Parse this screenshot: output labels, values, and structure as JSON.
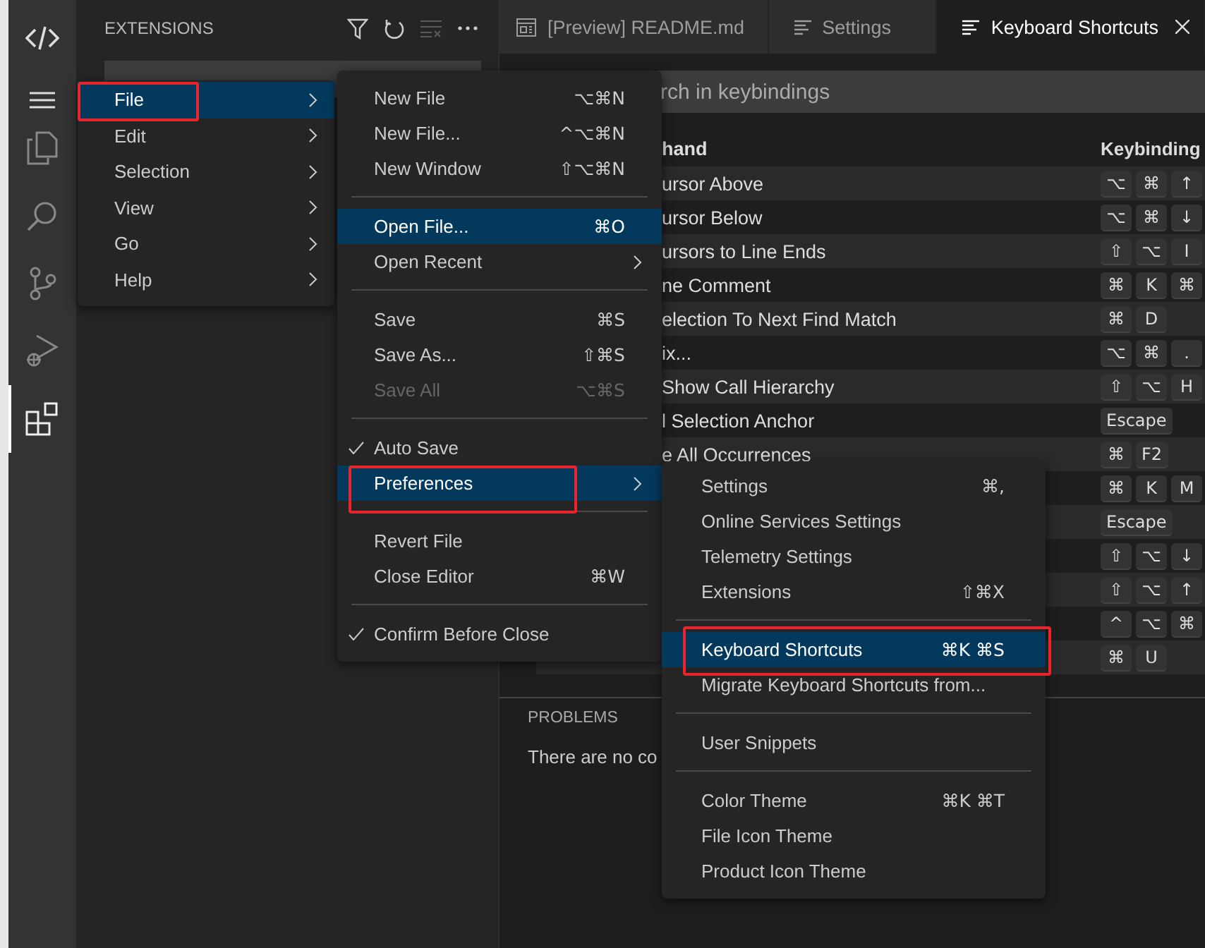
{
  "activity_bar": {
    "items": [
      {
        "kind": "logo",
        "selected": false
      },
      {
        "kind": "menu",
        "selected": false
      },
      {
        "kind": "files",
        "selected": false
      },
      {
        "kind": "search",
        "selected": false
      },
      {
        "kind": "source-control",
        "selected": false
      },
      {
        "kind": "run",
        "selected": false
      },
      {
        "kind": "extensions",
        "selected": true
      }
    ]
  },
  "sidebar": {
    "title": "EXTENSIONS",
    "actions": [
      {
        "kind": "filter",
        "disabled": false
      },
      {
        "kind": "refresh",
        "disabled": false
      },
      {
        "kind": "clear",
        "disabled": true
      },
      {
        "kind": "more",
        "disabled": false
      }
    ]
  },
  "tabs": [
    {
      "label": "[Preview] README.md",
      "kind": "preview",
      "selected": false,
      "closable": false
    },
    {
      "label": "Settings",
      "kind": "settings",
      "selected": false,
      "closable": false
    },
    {
      "label": "Keyboard Shortcuts",
      "kind": "settings",
      "selected": true,
      "closable": true
    }
  ],
  "keybindings": {
    "search": {
      "placeholder": "rch in keybindings"
    },
    "columns": [
      "hand",
      "Keybinding"
    ],
    "rows": [
      {
        "command": "ursor Above",
        "keys": [
          "⌥",
          "⌘",
          "↑"
        ]
      },
      {
        "command": "ursor Below",
        "keys": [
          "⌥",
          "⌘",
          "↓"
        ]
      },
      {
        "command": "ursors to Line Ends",
        "keys": [
          "⇧",
          "⌥",
          "I"
        ]
      },
      {
        "command": "ne Comment",
        "keys": [
          "⌘",
          "K",
          "⌘"
        ]
      },
      {
        "command": "election To Next Find Match",
        "keys": [
          "⌘",
          "D"
        ]
      },
      {
        "command": "ix...",
        "keys": [
          "⌥",
          "⌘",
          "."
        ]
      },
      {
        "command": "Show Call Hierarchy",
        "keys": [
          "⇧",
          "⌥",
          "H"
        ]
      },
      {
        "command": "l Selection Anchor",
        "keys": [
          "Escape"
        ]
      },
      {
        "command": "e All Occurrences",
        "keys": [
          "⌘",
          "F2"
        ]
      },
      {
        "keys": [
          "⌘",
          "K",
          "M"
        ]
      },
      {
        "keys": [
          "Escape"
        ]
      },
      {
        "keys": [
          "⇧",
          "⌥",
          "↓"
        ]
      },
      {
        "keys": [
          "⇧",
          "⌥",
          "↑"
        ]
      },
      {
        "keys": [
          "^",
          "⌥",
          "⌘"
        ]
      },
      {
        "keys": [
          "⌘",
          "U"
        ]
      }
    ]
  },
  "panel": {
    "tabs": [
      {
        "label": "PROBLEMS"
      }
    ],
    "message": "There are no co"
  },
  "menubar_menu": {
    "items": [
      {
        "label": "File",
        "selected": true,
        "highlighted": true
      },
      {
        "label": "Edit",
        "selected": false,
        "highlighted": false
      },
      {
        "label": "Selection",
        "selected": false,
        "highlighted": false
      },
      {
        "label": "View",
        "selected": false,
        "highlighted": false
      },
      {
        "label": "Go",
        "selected": false,
        "highlighted": false
      },
      {
        "label": "Help",
        "selected": false,
        "highlighted": false
      }
    ]
  },
  "file_menu": {
    "items": [
      {
        "kind": "item",
        "label": "New File",
        "shortcut": "⌥⌘N",
        "selected": false,
        "checked": false,
        "disabled": false,
        "submenu": false,
        "highlighted": false
      },
      {
        "kind": "item",
        "label": "New File...",
        "shortcut": "^⌥⌘N",
        "selected": false,
        "checked": false,
        "disabled": false,
        "submenu": false,
        "highlighted": false
      },
      {
        "kind": "item",
        "label": "New Window",
        "shortcut": "⇧⌥⌘N",
        "selected": false,
        "checked": false,
        "disabled": false,
        "submenu": false,
        "highlighted": false
      },
      {
        "kind": "separator"
      },
      {
        "kind": "item",
        "label": "Open File...",
        "shortcut": "⌘O",
        "selected": true,
        "checked": false,
        "disabled": false,
        "submenu": false,
        "highlighted": false
      },
      {
        "kind": "item",
        "label": "Open Recent",
        "selected": false,
        "checked": false,
        "disabled": false,
        "submenu": true,
        "highlighted": false
      },
      {
        "kind": "separator"
      },
      {
        "kind": "item",
        "label": "Save",
        "shortcut": "⌘S",
        "selected": false,
        "checked": false,
        "disabled": false,
        "submenu": false,
        "highlighted": false
      },
      {
        "kind": "item",
        "label": "Save As...",
        "shortcut": "⇧⌘S",
        "selected": false,
        "checked": false,
        "disabled": false,
        "submenu": false,
        "highlighted": false
      },
      {
        "kind": "item",
        "label": "Save All",
        "shortcut": "⌥⌘S",
        "selected": false,
        "checked": false,
        "disabled": true,
        "submenu": false,
        "highlighted": false
      },
      {
        "kind": "separator"
      },
      {
        "kind": "item",
        "label": "Auto Save",
        "selected": false,
        "checked": true,
        "disabled": false,
        "submenu": false,
        "highlighted": false
      },
      {
        "kind": "item",
        "label": "Preferences",
        "selected": true,
        "checked": false,
        "disabled": false,
        "submenu": true,
        "highlighted": true
      },
      {
        "kind": "separator"
      },
      {
        "kind": "item",
        "label": "Revert File",
        "selected": false,
        "checked": false,
        "disabled": false,
        "submenu": false,
        "highlighted": false
      },
      {
        "kind": "item",
        "label": "Close Editor",
        "shortcut": "⌘W",
        "selected": false,
        "checked": false,
        "disabled": false,
        "submenu": false,
        "highlighted": false
      },
      {
        "kind": "separator"
      },
      {
        "kind": "item",
        "label": "Confirm Before Close",
        "selected": false,
        "checked": true,
        "disabled": false,
        "submenu": false,
        "highlighted": false
      }
    ]
  },
  "preferences_menu": {
    "items": [
      {
        "kind": "item",
        "label": "Settings",
        "shortcut": "⌘,",
        "selected": false,
        "highlighted": false
      },
      {
        "kind": "item",
        "label": "Online Services Settings",
        "selected": false,
        "highlighted": false
      },
      {
        "kind": "item",
        "label": "Telemetry Settings",
        "selected": false,
        "highlighted": false
      },
      {
        "kind": "item",
        "label": "Extensions",
        "shortcut": "⇧⌘X",
        "selected": false,
        "highlighted": false
      },
      {
        "kind": "separator"
      },
      {
        "kind": "item",
        "label": "Keyboard Shortcuts",
        "shortcut": "⌘K ⌘S",
        "selected": true,
        "highlighted": true
      },
      {
        "kind": "item",
        "label": "Migrate Keyboard Shortcuts from...",
        "selected": false,
        "highlighted": false
      },
      {
        "kind": "separator"
      },
      {
        "kind": "item",
        "label": "User Snippets",
        "selected": false,
        "highlighted": false
      },
      {
        "kind": "separator"
      },
      {
        "kind": "item",
        "label": "Color Theme",
        "shortcut": "⌘K ⌘T",
        "selected": false,
        "highlighted": false
      },
      {
        "kind": "item",
        "label": "File Icon Theme",
        "selected": false,
        "highlighted": false
      },
      {
        "kind": "item",
        "label": "Product Icon Theme",
        "selected": false,
        "highlighted": false
      }
    ]
  }
}
